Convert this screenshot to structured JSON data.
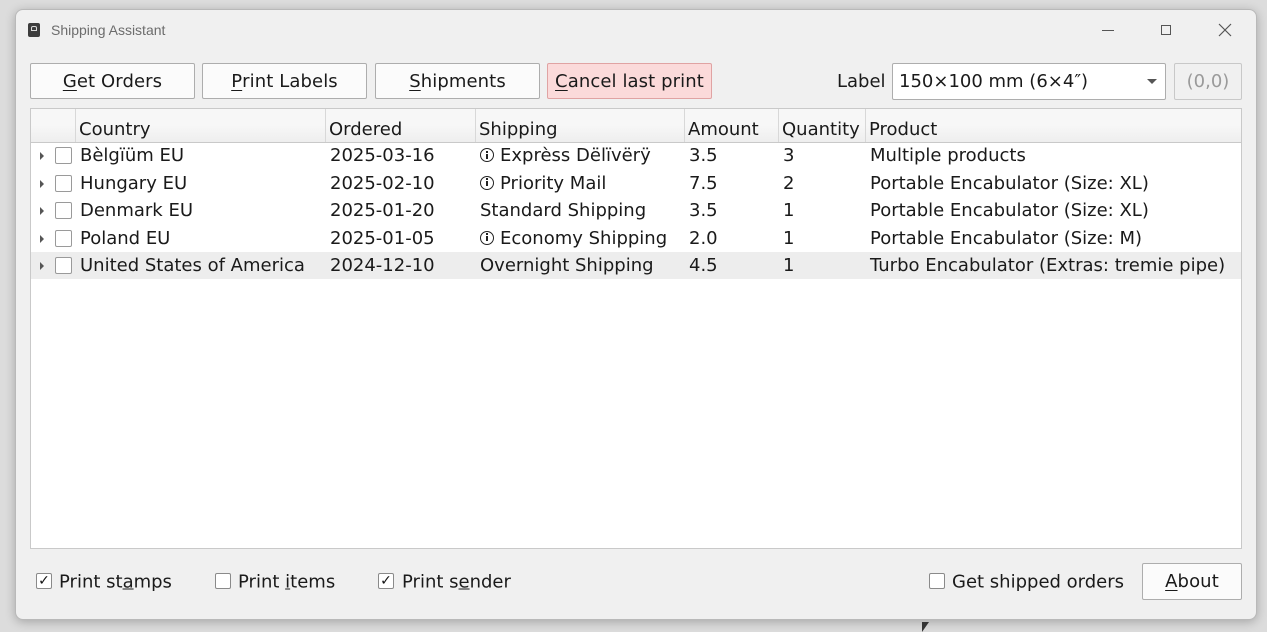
{
  "window": {
    "title": "Shipping Assistant"
  },
  "toolbar": {
    "get_orders": {
      "u": "G",
      "rest": "et Orders"
    },
    "print_labels": {
      "u": "P",
      "rest": "rint Labels"
    },
    "shipments": {
      "u": "S",
      "rest": "hipments"
    },
    "cancel": {
      "u": "C",
      "rest": "ancel last print"
    },
    "label_caption": "Label",
    "label_value": "150×100 mm (6×4″)",
    "coord": "(0,0)"
  },
  "colors": {
    "cancel_bg": "#fbdada",
    "selected_row": "#ededed"
  },
  "table": {
    "headers": [
      "Country",
      "Ordered",
      "Shipping",
      "Amount",
      "Quantity",
      "Product"
    ],
    "rows": [
      {
        "country": "Bèlgïüm EU",
        "ordered": "2025-03-16",
        "shipping": "Exprèss Dëlïvërÿ",
        "info": true,
        "amount": "3.5",
        "quantity": "3",
        "product": "Multiple products",
        "checked": false
      },
      {
        "country": "Hungary EU",
        "ordered": "2025-02-10",
        "shipping": "Priority Mail",
        "info": true,
        "amount": "7.5",
        "quantity": "2",
        "product": "Portable Encabulator  (Size: XL)",
        "checked": false
      },
      {
        "country": "Denmark EU",
        "ordered": "2025-01-20",
        "shipping": "Standard Shipping",
        "info": false,
        "amount": "3.5",
        "quantity": "1",
        "product": "Portable Encabulator  (Size: XL)",
        "checked": false
      },
      {
        "country": "Poland EU",
        "ordered": "2025-01-05",
        "shipping": "Economy Shipping",
        "info": true,
        "amount": "2.0",
        "quantity": "1",
        "product": "Portable Encabulator  (Size: M)",
        "checked": false
      },
      {
        "country": "United States of America",
        "ordered": "2024-12-10",
        "shipping": "Overnight Shipping",
        "info": false,
        "amount": "4.5",
        "quantity": "1",
        "product": "Turbo Encabulator (Extras: tremie pipe)",
        "checked": false,
        "selected": true
      }
    ]
  },
  "footer": {
    "print_stamps": {
      "pre": "Print st",
      "u": "a",
      "post": "mps",
      "checked": true
    },
    "print_items": {
      "pre": "Print ",
      "u": "i",
      "post": "tems",
      "checked": false
    },
    "print_sender": {
      "pre": "Print s",
      "u": "e",
      "post": "nder",
      "checked": true
    },
    "get_shipped": {
      "label": "Get shipped orders",
      "checked": false
    },
    "about": {
      "u": "A",
      "rest": "bout"
    }
  }
}
